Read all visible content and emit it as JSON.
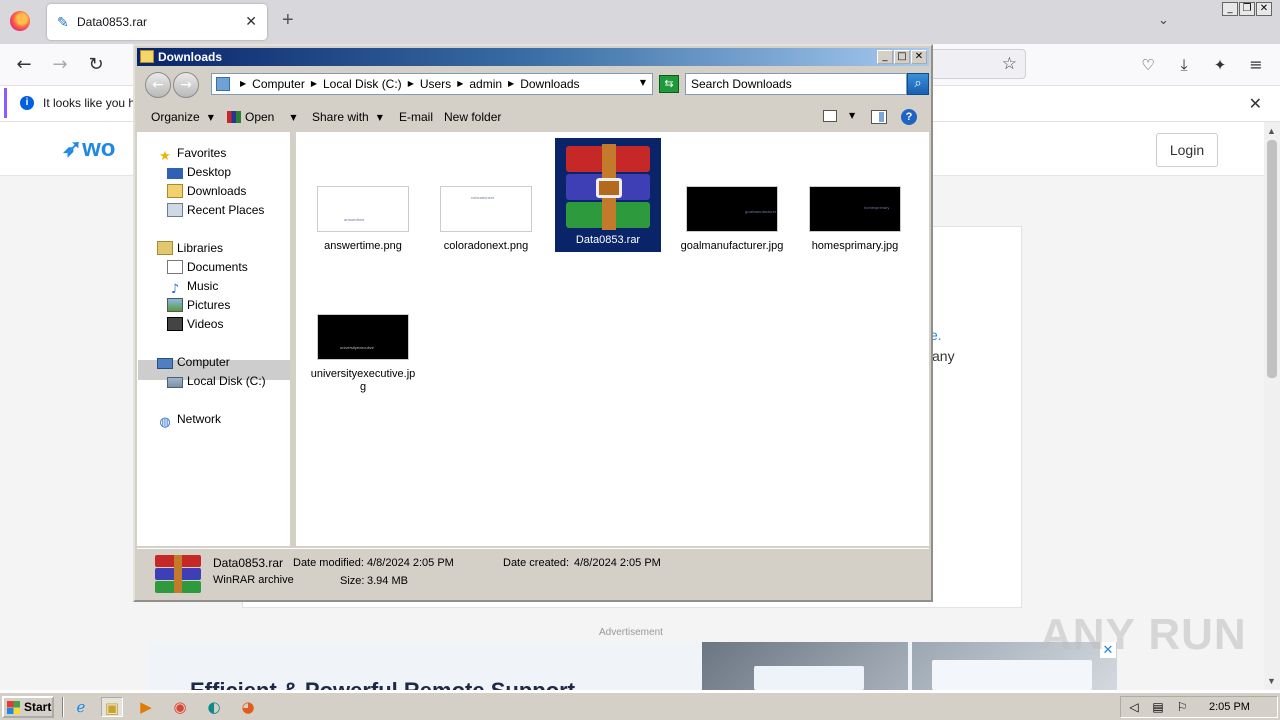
{
  "browser": {
    "tab_title": "Data0853.rar",
    "tab_close": "✕",
    "new_tab": "+",
    "list_tabs": "⌄",
    "window_controls": [
      "_",
      "❐",
      "✕"
    ],
    "nav": {
      "back": "←",
      "forward": "→",
      "reload": "↻"
    },
    "bookmark_star": "☆",
    "toolbar_icons": [
      "pocket-icon",
      "download-icon",
      "extensions-icon",
      "menu-icon"
    ],
    "notification": {
      "text": "It looks like you ha",
      "close": "✕"
    }
  },
  "webpage": {
    "logo_text": "wo",
    "login_label": "Login",
    "peek_link": "e.",
    "peek_text": "any",
    "ad_label": "Advertisement",
    "ad_headline": "Efficient & Powerful Remote Support",
    "ad_close": "✕",
    "watermark": "ANY RUN"
  },
  "explorer": {
    "title": "Downloads",
    "window_controls": [
      "_",
      "□",
      "✕"
    ],
    "breadcrumb": [
      "Computer",
      "Local Disk (C:)",
      "Users",
      "admin",
      "Downloads"
    ],
    "search_placeholder": "Search Downloads",
    "toolbar": {
      "organize": "Organize",
      "open": "Open",
      "share_with": "Share with",
      "email": "E-mail",
      "new_folder": "New folder",
      "help": "?"
    },
    "nav_tree": {
      "favorites": "Favorites",
      "desktop": "Desktop",
      "downloads": "Downloads",
      "recent_places": "Recent Places",
      "libraries": "Libraries",
      "documents": "Documents",
      "music": "Music",
      "pictures": "Pictures",
      "videos": "Videos",
      "computer": "Computer",
      "local_disk": "Local Disk (C:)",
      "network": "Network"
    },
    "files": [
      {
        "name": "answertime.png",
        "thumb": "white"
      },
      {
        "name": "coloradonext.png",
        "thumb": "white"
      },
      {
        "name": "Data0853.rar",
        "thumb": "rar",
        "selected": true
      },
      {
        "name": "goalmanufacturer.jpg",
        "thumb": "black"
      },
      {
        "name": "homesprimary.jpg",
        "thumb": "black"
      },
      {
        "name": "universityexecutive.jpg",
        "thumb": "black"
      }
    ],
    "details": {
      "file_name": "Data0853.rar",
      "file_type": "WinRAR archive",
      "date_modified_label": "Date modified:",
      "date_modified": "4/8/2024 2:05 PM",
      "size_label": "Size:",
      "size": "3.94 MB",
      "date_created_label": "Date created:",
      "date_created": "4/8/2024 2:05 PM"
    }
  },
  "taskbar": {
    "start_label": "Start",
    "clock": "2:05 PM",
    "apps": [
      "ie-icon",
      "explorer-icon",
      "media-player-icon",
      "chrome-icon",
      "edge-icon",
      "firefox-icon"
    ]
  },
  "colors": {
    "title_bar": "#0a246a",
    "selection": "#0a246a",
    "classic_face": "#d4d0c8",
    "firefox_accent": "#9059ff"
  }
}
